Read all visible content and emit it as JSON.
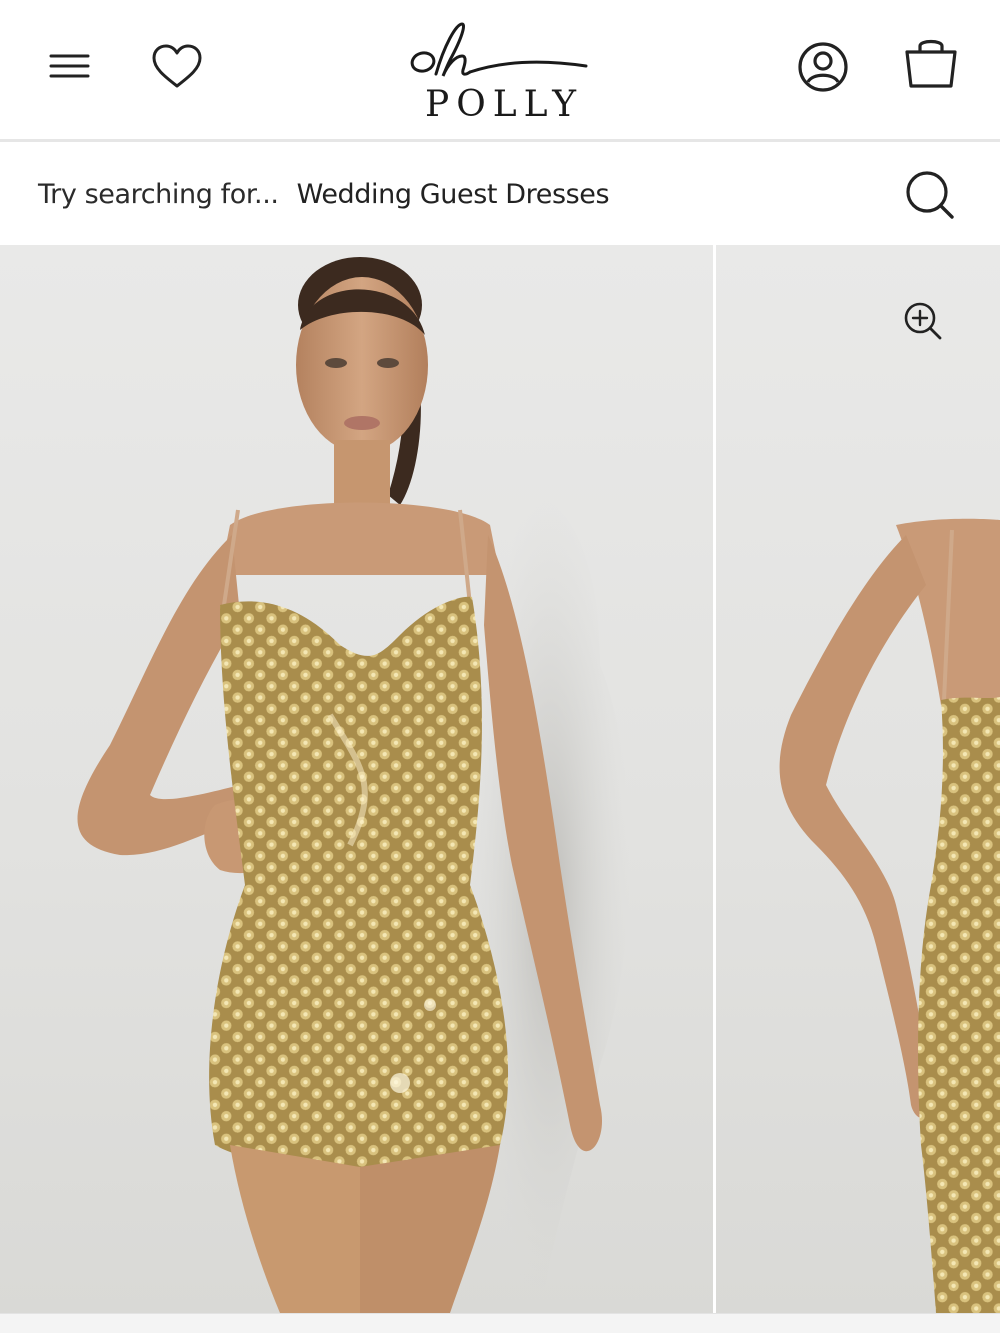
{
  "brand": {
    "logo_script": "oh",
    "logo_word": "POLLY"
  },
  "header": {
    "icons": [
      "menu-icon",
      "heart-icon",
      "account-icon",
      "bag-icon"
    ]
  },
  "search": {
    "prompt": "Try searching for...",
    "suggestion": "Wedding Guest Dresses",
    "icon": "search-icon"
  },
  "gallery": {
    "zoom_icon": "zoom-in-icon",
    "images": [
      {
        "alt": "Model wearing gold embellished mini dress, front view"
      },
      {
        "alt": "Model wearing gold embellished mini dress, back view"
      }
    ]
  },
  "colors": {
    "dress_gold": "#b89a55",
    "skin": "#c99a77",
    "background_photo": "#e5e5e3",
    "divider": "#e6e6e6"
  }
}
